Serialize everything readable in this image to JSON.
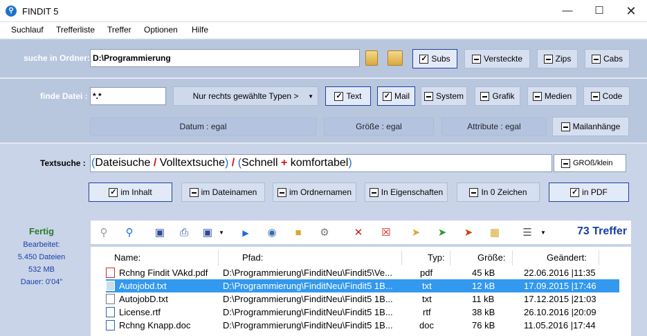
{
  "window": {
    "title": "FINDIT  5",
    "icon": "magnifier-icon"
  },
  "menu": [
    "Suchlauf",
    "Trefferliste",
    "Treffer",
    "Optionen",
    "Hilfe"
  ],
  "folder": {
    "label": "suche in Ordner:",
    "value": "D:\\Programmierung",
    "subs": "Subs",
    "versteckte": "Versteckte",
    "zips": "Zips",
    "cabs": "Cabs"
  },
  "file": {
    "label": "finde Datei :",
    "value": "*.*",
    "types_dropdown": "Nur rechts gewählte Typen >",
    "text": "Text",
    "mail": "Mail",
    "system": "System",
    "grafik": "Grafik",
    "medien": "Medien",
    "code": "Code"
  },
  "filters": {
    "datum": "Datum : egal",
    "groesse": "Größe : egal",
    "attribute": "Attribute : egal",
    "mailanhaenge": "Mailanhänge"
  },
  "textsearch": {
    "label": "Textsuche :",
    "paren_open1": "(",
    "dateisuche": "Dateisuche",
    "slash1": "/",
    "volltextsuche": "Volltextsuche",
    "paren_close1": ")",
    "slash2": "/",
    "paren_open2": "(",
    "schnell": "Schnell",
    "plus": "+",
    "komfortabel": "komfortabel",
    "paren_close2": ")",
    "case": "GROß/klein"
  },
  "scope": {
    "inhalt": "im Inhalt",
    "dateinamen": "im Dateinamen",
    "ordnernamen": "im Ordnernamen",
    "eigenschaften": "In Eigenschaften",
    "zeichen": "In 0 Zeichen",
    "pdf": "in PDF"
  },
  "status": {
    "state": "Fertig",
    "bearbeitet": "Bearbeitet:",
    "dateien": "5.450 Dateien",
    "size": "532 MB",
    "dauer": "Dauer: 0'04\""
  },
  "results": {
    "count": "73 Treffer",
    "columns": {
      "name": "Name:",
      "pfad": "Pfad:",
      "typ": "Typ:",
      "groesse": "Größe:",
      "geaendert": "Geändert:"
    },
    "rows": [
      {
        "name": "Rchng Findit VAkd.pdf",
        "path": "D:\\Programmierung\\FinditNeu\\Findit5\\Ve...",
        "type": "pdf",
        "size": "45 kB",
        "date": "22.06.2016 |11:35",
        "icon": "pdf-icon"
      },
      {
        "name": "Autojobd.txt",
        "path": "D:\\Programmierung\\FinditNeu\\Findit5 1B...",
        "type": "txt",
        "size": "12 kB",
        "date": "17.09.2015 |17:46",
        "icon": "text-file-icon"
      },
      {
        "name": "AutojobD.txt",
        "path": "D:\\Programmierung\\FinditNeu\\Findit5 1B...",
        "type": "txt",
        "size": "11 kB",
        "date": "17.12.2015 |21:03",
        "icon": "text-file-icon"
      },
      {
        "name": "License.rtf",
        "path": "D:\\Programmierung\\FinditNeu\\Findit5 1B...",
        "type": "rtf",
        "size": "38 kB",
        "date": "26.10.2016 |20:09",
        "icon": "word-file-icon"
      },
      {
        "name": "Rchng Knapp.doc",
        "path": "D:\\Programmierung\\FinditNeu\\Findit5 1B...",
        "type": "doc",
        "size": "76 kB",
        "date": "11.05.2016 |17:44",
        "icon": "word-file-icon"
      }
    ]
  }
}
